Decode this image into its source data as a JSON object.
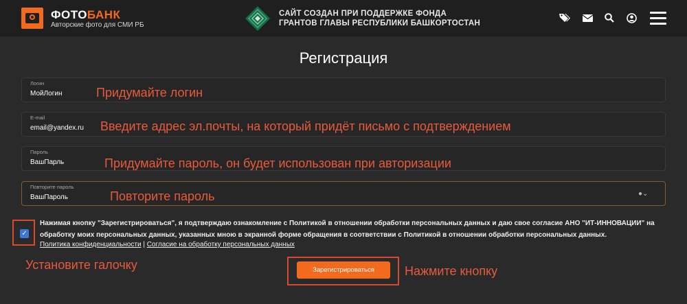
{
  "header": {
    "brand_part1": "ФОТО",
    "brand_part2": "БАНК",
    "brand_sub": "Авторские фото для СМИ РБ",
    "fund_line1": "САЙТ СОЗДАН ПРИ ПОДДЕРЖКЕ ФОНДА",
    "fund_line2": "ГРАНТОВ ГЛАВЫ РЕСПУБЛИКИ БАШКОРТОСТАН",
    "icons": [
      "tags-icon",
      "envelope-icon",
      "search-icon",
      "user-icon",
      "menu-icon"
    ],
    "accent": "#f26a1d"
  },
  "page_title": "Регистрация",
  "fields": {
    "login": {
      "label": "Логин",
      "value": "МойЛогин",
      "hint": "Придумайте логин"
    },
    "email": {
      "label": "E-mail",
      "value": "email@yandex.ru",
      "hint": "Введите адрес эл.почты, на который придёт письмо с подтверждением"
    },
    "password": {
      "label": "Пароль",
      "value": "ВашПарль",
      "hint": "Придумайте пароль, он будет использован при авторизации"
    },
    "password_repeat": {
      "label": "Повторите пароль",
      "value": "ВашПароль",
      "hint": "Повторите пароль"
    }
  },
  "consent": {
    "checked": true,
    "text": "Нажимая кнопку \"Зарегистрироваться\", я подтверждаю ознакомление с Политикой в отношении обработки персональных данных и даю свое согласие АНО \"ИТ-ИННОВАЦИИ\" на обработку моих персональных данных, указанных мною в экранной форме обращения в соответствии с Политикой в отношении обработки персональных данных.",
    "link_privacy": "Политика конфиденциальности",
    "separator": "|",
    "link_agreement": "Согласие на обработку персональных данных",
    "hint": "Установите галочку"
  },
  "submit": {
    "label": "Зарегистрироваться",
    "hint": "Нажмите кнопку"
  },
  "colors": {
    "hint": "#e85a3c",
    "button": "#f26a1d",
    "checkbox": "#3b78d8"
  }
}
